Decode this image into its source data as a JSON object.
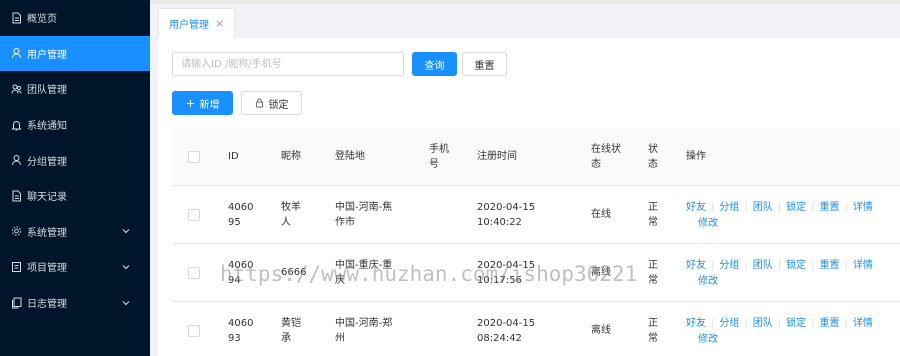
{
  "sidebar": {
    "items": [
      {
        "label": "概览页",
        "icon": "document-icon",
        "active": false,
        "expandable": false
      },
      {
        "label": "用户管理",
        "icon": "user-icon",
        "active": true,
        "expandable": false
      },
      {
        "label": "团队管理",
        "icon": "team-icon",
        "active": false,
        "expandable": false
      },
      {
        "label": "系统通知",
        "icon": "bell-icon",
        "active": false,
        "expandable": false
      },
      {
        "label": "分组管理",
        "icon": "user-icon",
        "active": false,
        "expandable": false
      },
      {
        "label": "聊天记录",
        "icon": "document-icon",
        "active": false,
        "expandable": false
      },
      {
        "label": "系统管理",
        "icon": "gear-icon",
        "active": false,
        "expandable": true
      },
      {
        "label": "项目管理",
        "icon": "project-icon",
        "active": false,
        "expandable": true
      },
      {
        "label": "日志管理",
        "icon": "log-icon",
        "active": false,
        "expandable": true
      }
    ]
  },
  "tabs": [
    {
      "label": "用户管理",
      "close": "×"
    }
  ],
  "search": {
    "placeholder": "请输入ID /昵称/手机号",
    "value": ""
  },
  "buttons": {
    "query": "查询",
    "reset": "重置",
    "add": "新增",
    "lock": "锁定"
  },
  "table": {
    "headers": {
      "id": "ID",
      "nickname": "昵称",
      "location": "登陆地",
      "phone": "手机\n号",
      "register_time": "注册时间",
      "online": "在线状\n态",
      "status": "状\n态",
      "actions": "操作"
    },
    "rows": [
      {
        "id": "4060\n95",
        "nickname": "牧羊\n人",
        "location": "中国-河南-焦\n作市",
        "phone": "",
        "register_time": "2020-04-15\n10:40:22",
        "online": "在线",
        "status": "正\n常"
      },
      {
        "id": "4060\n94",
        "nickname": "6666",
        "location": "中国-重庆-重\n庆",
        "phone": "",
        "register_time": "2020-04-15\n10:17:56",
        "online": "离线",
        "status": "正\n常"
      },
      {
        "id": "4060\n93",
        "nickname": "黄铠\n承",
        "location": "中国-河南-郑\n州",
        "phone": "",
        "register_time": "2020-04-15\n08:24:42",
        "online": "离线",
        "status": "正\n常"
      }
    ],
    "actions": [
      "好友",
      "分组",
      "团队",
      "锁定",
      "重置",
      "详情",
      "修改"
    ]
  },
  "watermark": "https://www.huzhan.com/ishop36221",
  "colors": {
    "sidebar_bg": "#001529",
    "accent": "#1890ff",
    "page_bg": "#f0f2f5"
  }
}
